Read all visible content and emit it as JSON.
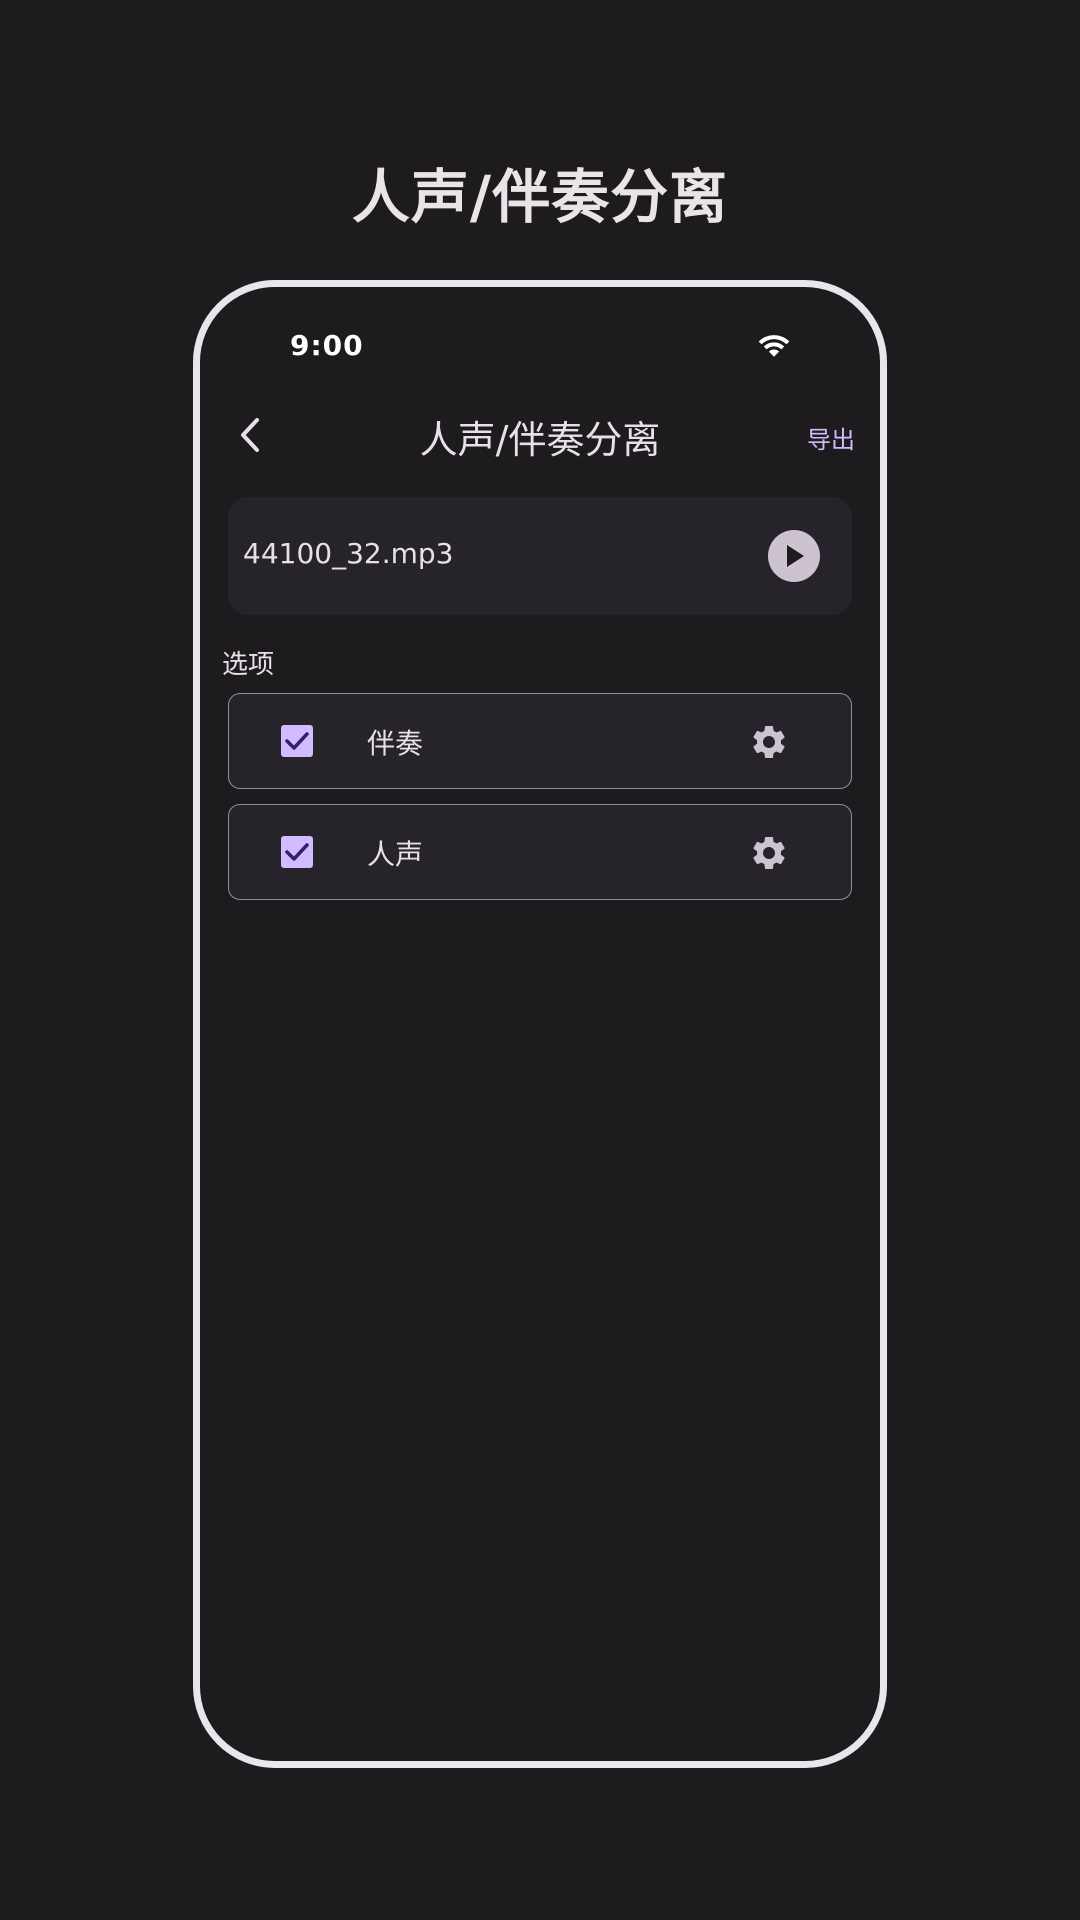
{
  "hero": {
    "title": "人声/伴奏分离"
  },
  "status_bar": {
    "time": "9:00",
    "wifi_icon": "wifi-icon"
  },
  "appbar": {
    "back_icon": "chevron-left-icon",
    "title": "人声/伴奏分离",
    "action_label": "导出"
  },
  "file": {
    "name": "44100_32.mp3",
    "play_icon": "play-icon"
  },
  "options": {
    "section_label": "选项",
    "items": [
      {
        "label": "伴奏",
        "checked": true,
        "settings_icon": "gear-icon"
      },
      {
        "label": "人声",
        "checked": true,
        "settings_icon": "gear-icon"
      }
    ]
  },
  "colors": {
    "background": "#1d1b1e",
    "surface": "#26242a",
    "accent": "#d0bcff",
    "check_mark": "#381e72",
    "outline": "#938f99",
    "icon_gray": "#ccc2d0"
  }
}
